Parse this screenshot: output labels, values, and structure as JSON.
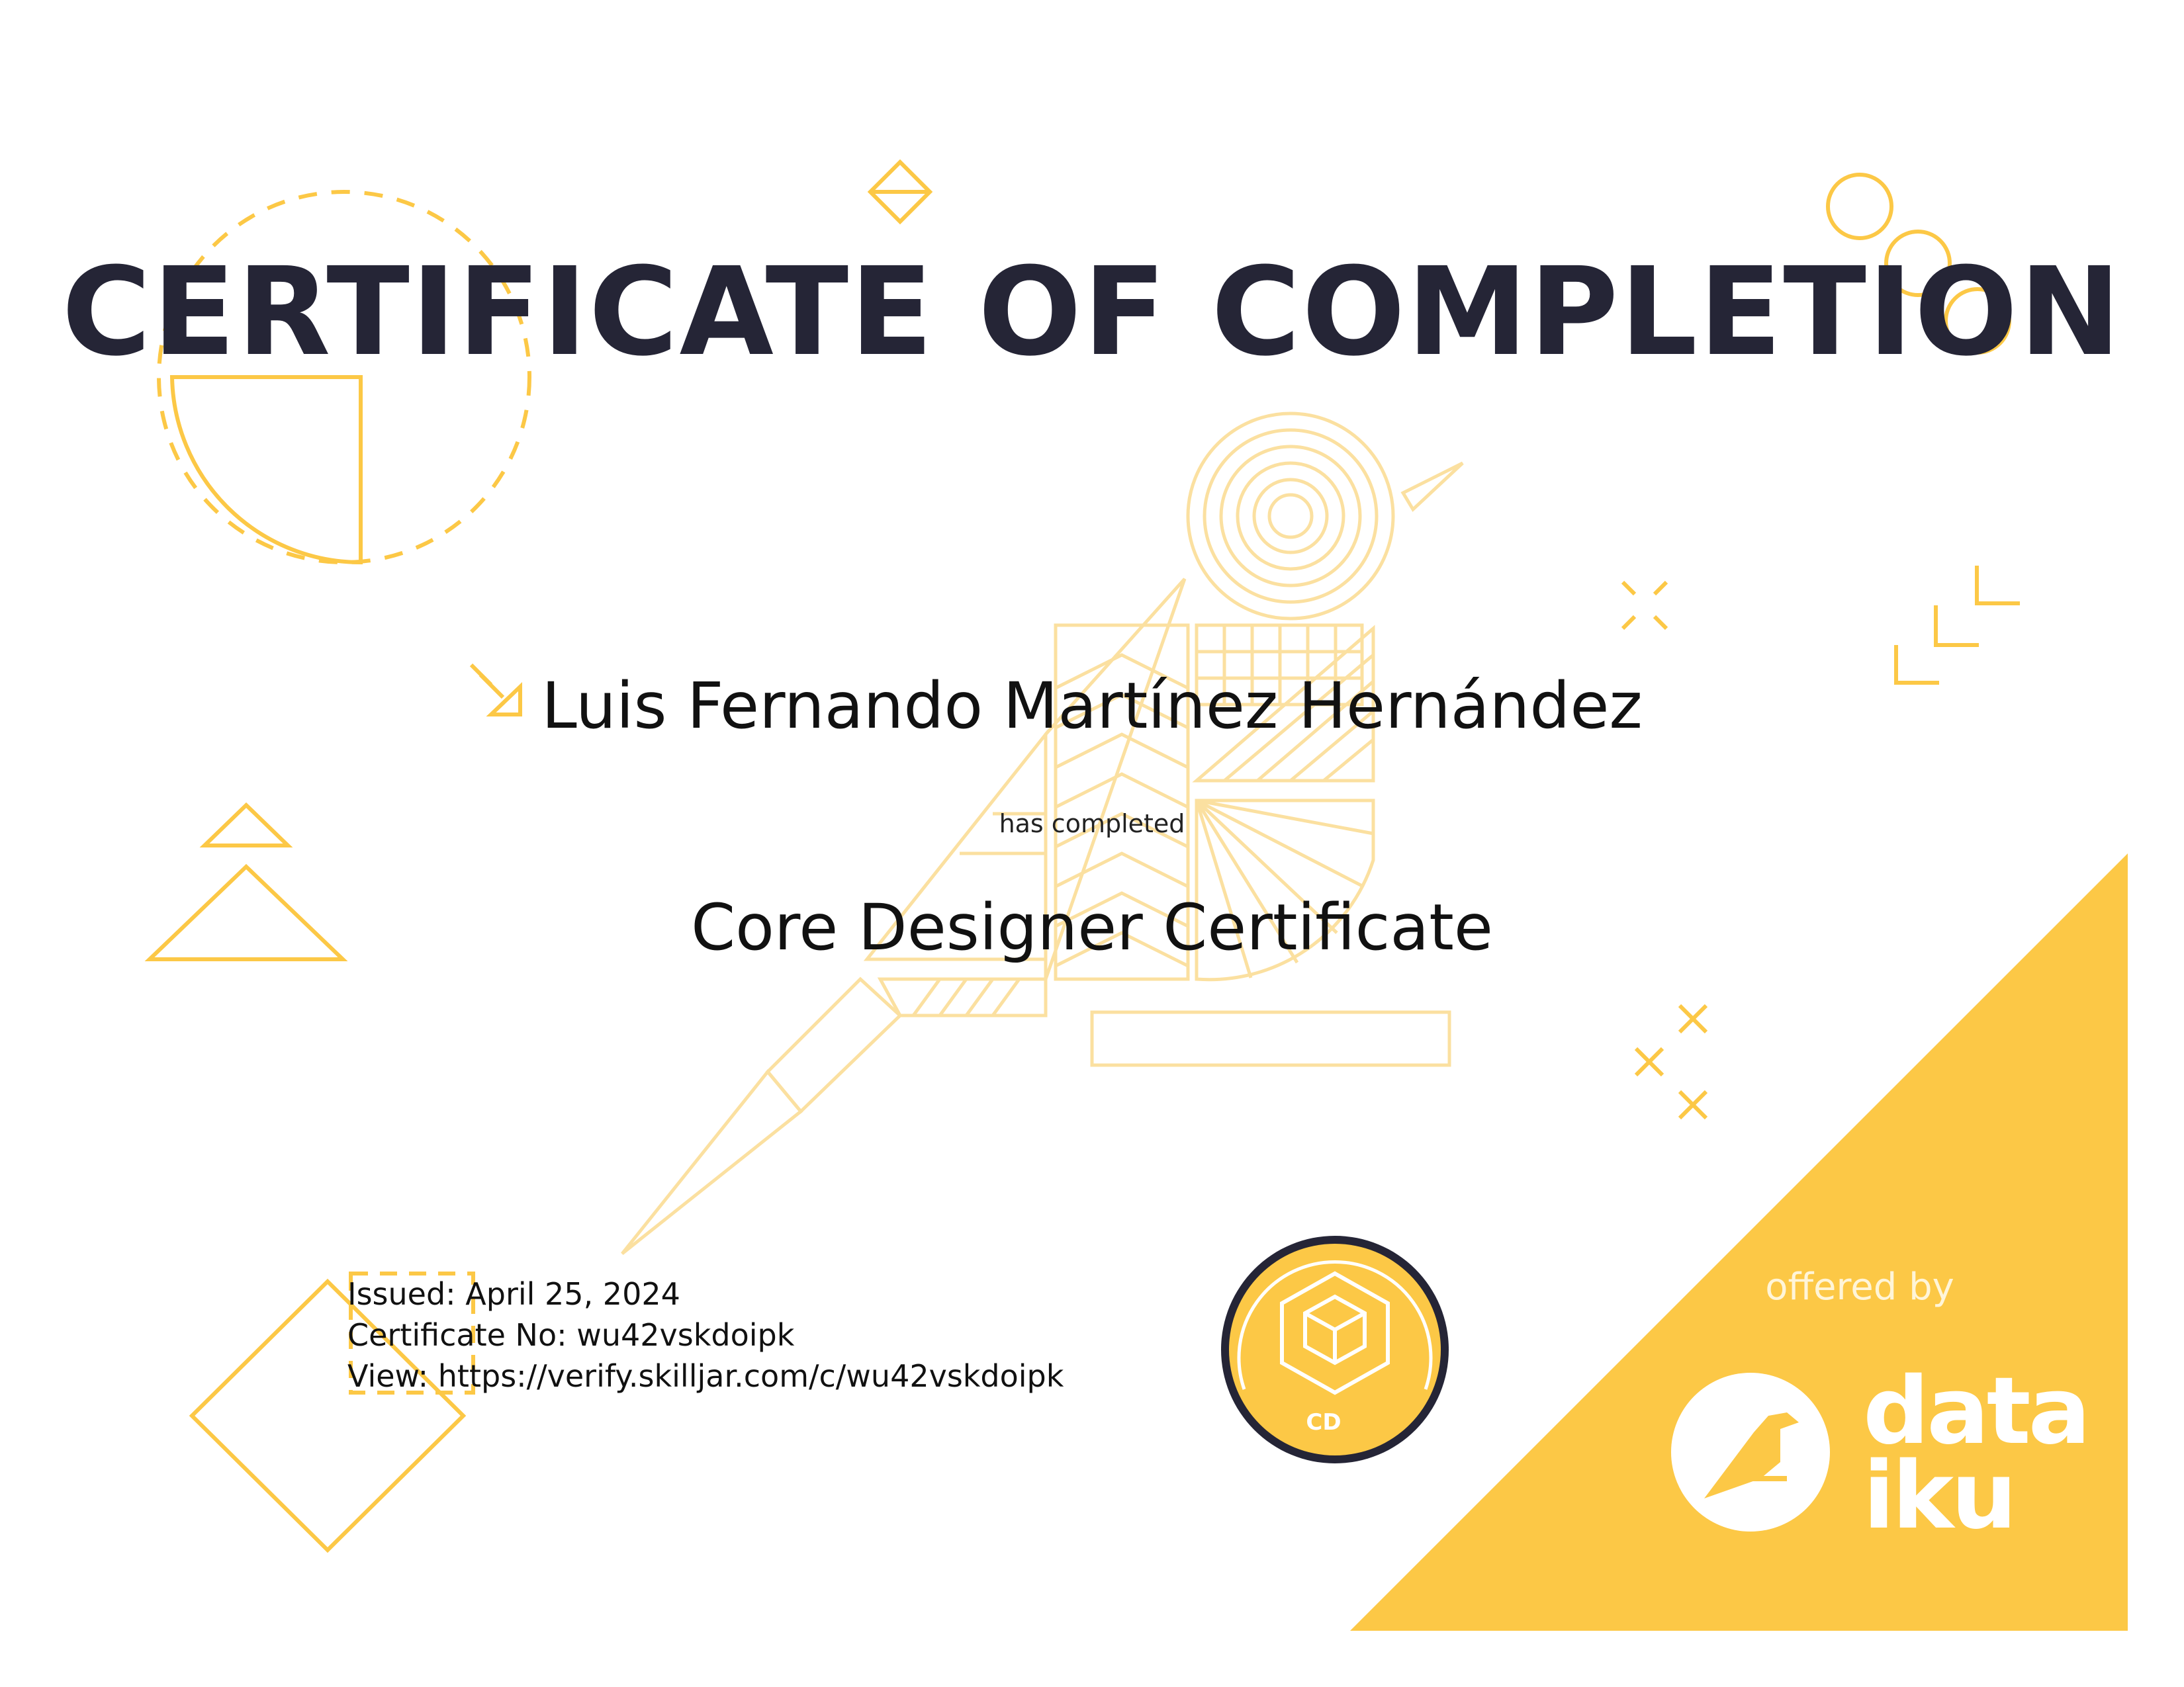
{
  "certificate": {
    "title": "CERTIFICATE OF COMPLETION",
    "recipient": "Luis Fernando Martínez Hernández",
    "completed_text": "has completed",
    "course": "Core Designer Certificate",
    "issued": "Issued: April 25, 2024",
    "certificate_no": "Certificate No: wu42vskdoipk",
    "view": "View: https://verify.skilljar.com/c/wu42vskdoipk"
  },
  "badge": {
    "label": "CD",
    "icon": "cube-icon"
  },
  "provider": {
    "offered_by": "offered by",
    "logo_line1": "data",
    "logo_line2": "iku",
    "logo_icon": "bird-icon"
  },
  "colors": {
    "accent_yellow": "#fcc846",
    "line_yellow": "#fad46a",
    "title_dark": "#252536",
    "badge_ring": "#252536"
  }
}
